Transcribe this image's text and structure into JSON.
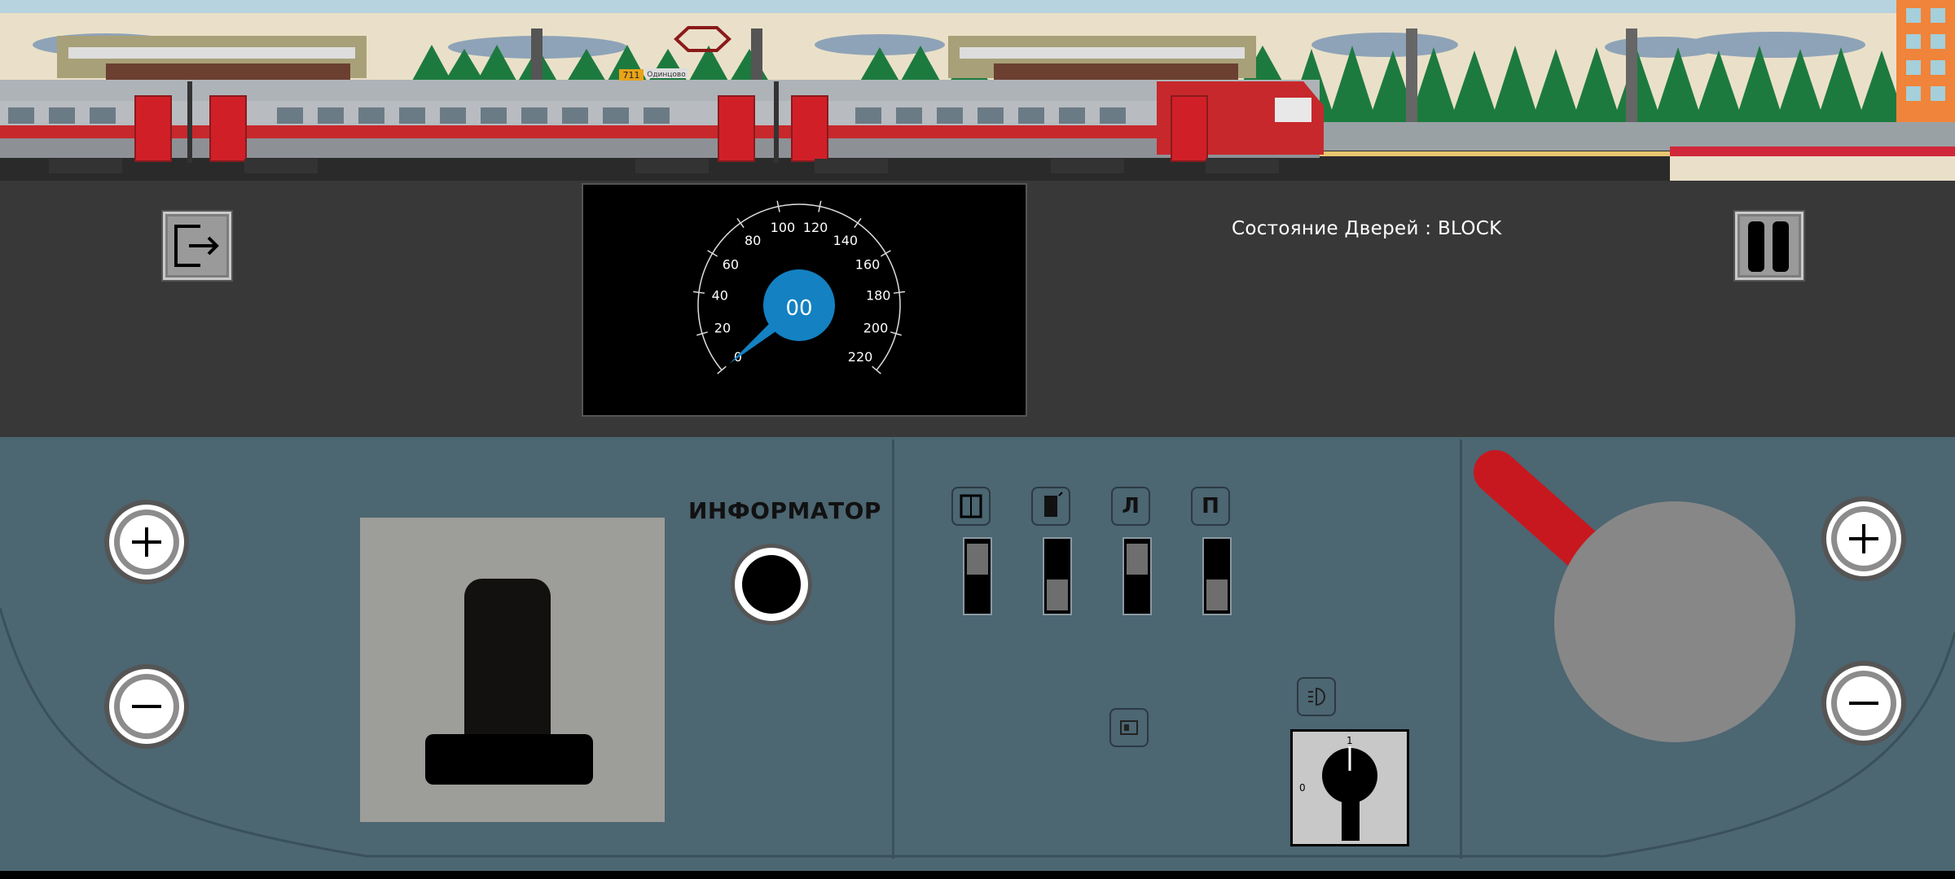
{
  "scene": {
    "train_route_sign": "711",
    "train_destination": "Одинцово"
  },
  "speedometer": {
    "speed_readout": "00",
    "max_speed": 220,
    "tick_labels": [
      "0",
      "20",
      "40",
      "60",
      "80",
      "100",
      "120",
      "140",
      "160",
      "180",
      "200",
      "220"
    ],
    "needle_value": 0
  },
  "door_status": {
    "label": "Состояние Дверей : BLOCK"
  },
  "informator": {
    "label": "ИНФОРМАТОР"
  },
  "switch_labels": {
    "left_door": "Л",
    "right_door": "П"
  },
  "rotary_switch": {
    "pos_0": "0",
    "pos_1": "1"
  },
  "colors": {
    "panel": "#4c6672",
    "upper_panel": "#383838",
    "speed_hub": "#1481c2",
    "brake_handle": "#c8181f"
  }
}
